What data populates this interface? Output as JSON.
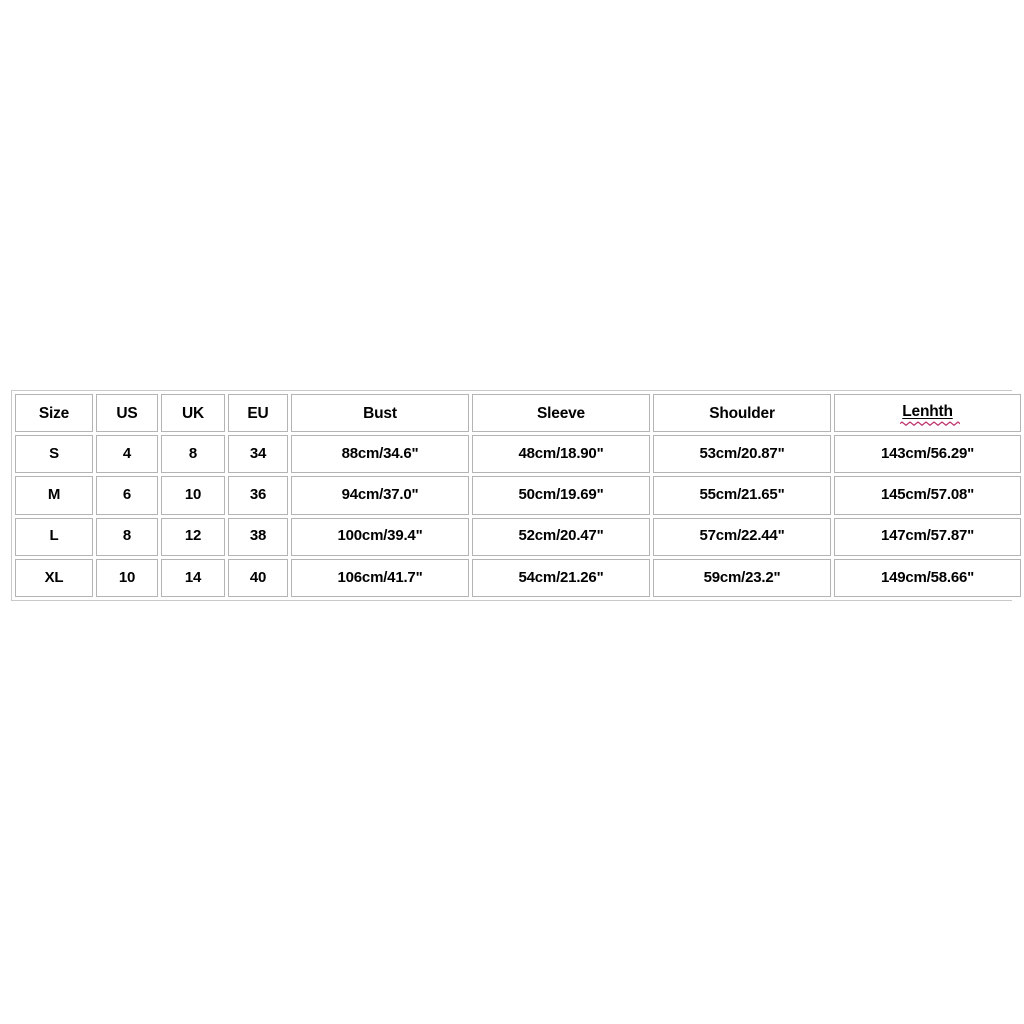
{
  "page": {
    "background_color": "#ffffff"
  },
  "size_chart": {
    "border_color": "#b4b4b4",
    "frame_color": "#c9c9c9",
    "text_color": "#000000",
    "spellcheck_squiggle_color": "#c0306a",
    "columns": [
      {
        "key": "size",
        "label": "Size"
      },
      {
        "key": "us",
        "label": "US"
      },
      {
        "key": "uk",
        "label": "UK"
      },
      {
        "key": "eu",
        "label": "EU"
      },
      {
        "key": "bust",
        "label": "Bust"
      },
      {
        "key": "sleeve",
        "label": "Sleeve"
      },
      {
        "key": "shoulder",
        "label": "Shoulder"
      },
      {
        "key": "lenhth",
        "label": "Lenhth",
        "misspelled": true
      }
    ],
    "rows": [
      {
        "size": "S",
        "us": "4",
        "uk": "8",
        "eu": "34",
        "bust": "88cm/34.6\"",
        "sleeve": "48cm/18.90\"",
        "shoulder": "53cm/20.87\"",
        "lenhth": "143cm/56.29\""
      },
      {
        "size": "M",
        "us": "6",
        "uk": "10",
        "eu": "36",
        "bust": "94cm/37.0\"",
        "sleeve": "50cm/19.69\"",
        "shoulder": "55cm/21.65\"",
        "lenhth": "145cm/57.08\""
      },
      {
        "size": "L",
        "us": "8",
        "uk": "12",
        "eu": "38",
        "bust": "100cm/39.4\"",
        "sleeve": "52cm/20.47\"",
        "shoulder": "57cm/22.44\"",
        "lenhth": "147cm/57.87\""
      },
      {
        "size": "XL",
        "us": "10",
        "uk": "14",
        "eu": "40",
        "bust": "106cm/41.7\"",
        "sleeve": "54cm/21.26\"",
        "shoulder": "59cm/23.2\"",
        "lenhth": "149cm/58.66\""
      }
    ]
  }
}
